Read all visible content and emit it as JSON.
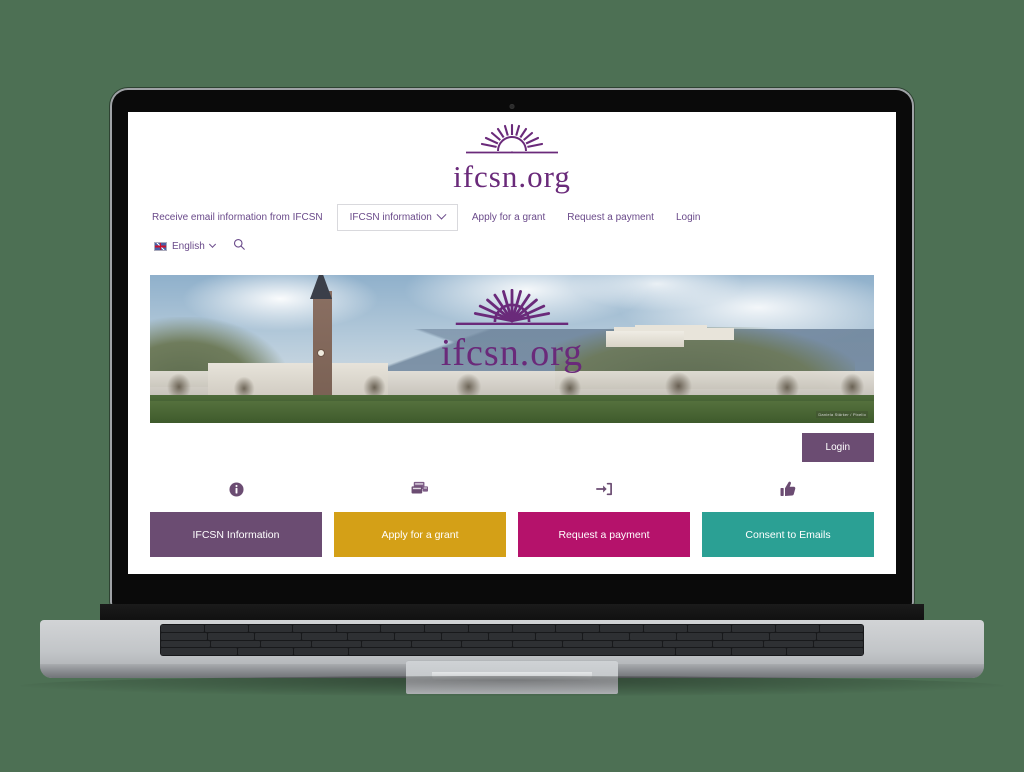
{
  "background_color": "#4d7054",
  "device": {
    "type": "laptop-mockup",
    "webcam": "webcam-dot"
  },
  "site": {
    "logo_text": "ifcsn.org",
    "logo_icon": "sunburst-icon",
    "brand_purple": "#6a2a7a"
  },
  "nav": {
    "primary": [
      {
        "label": "Receive email information from IFCSN",
        "type": "link"
      },
      {
        "label": "IFCSN information",
        "type": "dropdown",
        "icon": "chevron-down-icon"
      },
      {
        "label": "Apply for a grant",
        "type": "link"
      },
      {
        "label": "Request a payment",
        "type": "link"
      },
      {
        "label": "Login",
        "type": "link"
      }
    ],
    "language": {
      "label": "English",
      "flag": "uk-flag-icon",
      "chevron": "chevron-down-icon"
    },
    "search": {
      "icon": "search-icon",
      "label": "Search"
    }
  },
  "hero": {
    "alt": "Salzburg cityscape with river, church tower and hilltop fortress",
    "logo_text": "ifcsn.org",
    "credit": "Daniela Stärker / Pixelio"
  },
  "login_button": {
    "label": "Login",
    "color": "#6b4c72"
  },
  "tiles": [
    {
      "icon": "info-circle-icon",
      "label": "IFCSN Information",
      "color": "#6b4c72"
    },
    {
      "icon": "payment-cards-icon",
      "label": "Apply for a grant",
      "color": "#d4a017"
    },
    {
      "icon": "sign-in-icon",
      "label": "Request a payment",
      "color": "#b5126b"
    },
    {
      "icon": "thumbs-up-icon",
      "label": "Consent to Emails",
      "color": "#2ba094"
    }
  ]
}
